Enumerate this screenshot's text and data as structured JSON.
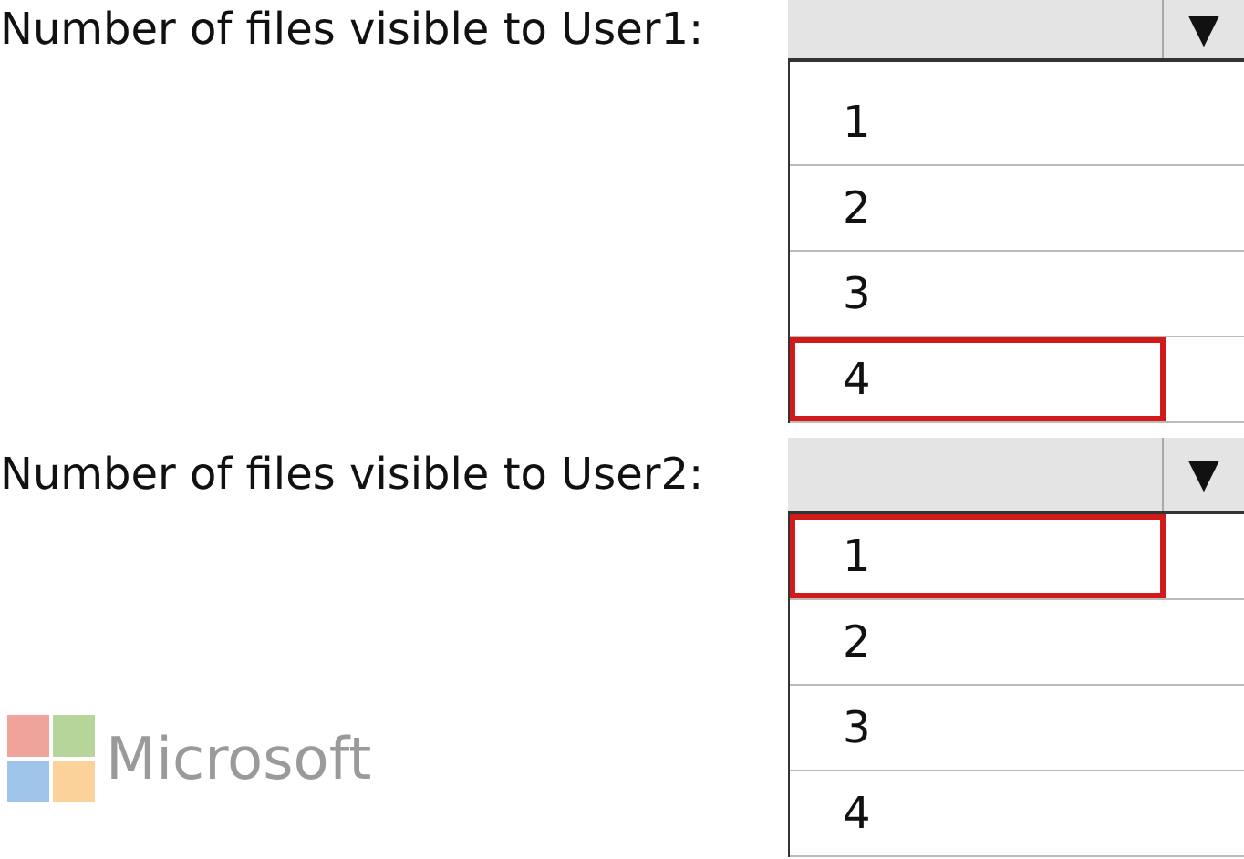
{
  "questions": [
    {
      "label": "Number of files visible to User1:",
      "arrow": "▼",
      "options": [
        {
          "text": "1",
          "selected": false
        },
        {
          "text": "2",
          "selected": false
        },
        {
          "text": "3",
          "selected": false
        },
        {
          "text": "4",
          "selected": true
        }
      ]
    },
    {
      "label": "Number of files visible to User2:",
      "arrow": "▼",
      "options": [
        {
          "text": "1",
          "selected": true
        },
        {
          "text": "2",
          "selected": false
        },
        {
          "text": "3",
          "selected": false
        },
        {
          "text": "4",
          "selected": false
        }
      ]
    }
  ],
  "logo": {
    "text": "Microsoft"
  }
}
